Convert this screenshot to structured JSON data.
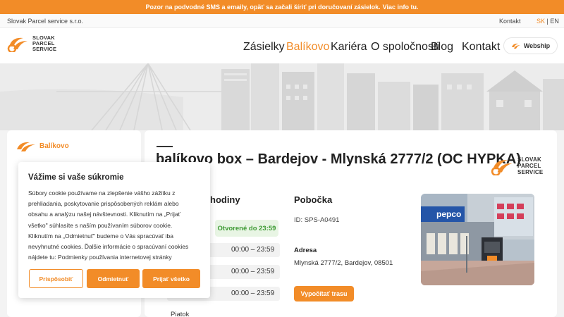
{
  "alert": {
    "text": "Pozor na podvodné SMS a emaily, opäť sa začali šíriť pri doručovaní zásielok.",
    "link": "Viac info tu."
  },
  "topbar": {
    "company": "Slovak Parcel service s.r.o.",
    "contact": "Kontakt",
    "lang_sk": "SK",
    "lang_sep": " | ",
    "lang_en": "EN"
  },
  "logo": {
    "line1": "SLOVAK",
    "line2": "PARCEL",
    "line3": "SERVICE"
  },
  "nav": {
    "items": [
      "Zásielky",
      "Balíkovo",
      "Kariéra",
      "O spoločnosti",
      "Blog",
      "Kontakt"
    ],
    "active_index": 1
  },
  "webship": {
    "label": "Webship"
  },
  "sidebar": {
    "title": "Balíkovo"
  },
  "main": {
    "title": "balíkovo box – Bardejov - Mlynská 2777/2 (OC HYPKA)",
    "hours_heading": "hodiny",
    "open_status": "Otvorené do 23:59",
    "hours": [
      {
        "day": "",
        "time": "00:00 – 23:59"
      },
      {
        "day": "",
        "time": "00:00 – 23:59"
      },
      {
        "day": "",
        "time": "00:00 – 23:59"
      },
      {
        "day": "Piatok",
        "time": ""
      }
    ],
    "branch_heading": "Pobočka",
    "branch_id": "ID: SPS-A0491",
    "address_label": "Adresa",
    "address_value": "Mlynská 2777/2, Bardejov, 08501",
    "route_button": "Vypočítať trasu",
    "photo_sign": "pepco"
  },
  "cookie": {
    "title": "Vážime si vaše súkromie",
    "lines": [
      "Súbory cookie používame na zlepšenie vášho zážitku z",
      "prehliadania, poskytovanie prispôsobených reklám alebo",
      "obsahu a analýzu našej návštevnosti. Kliknutím na „Prijať",
      "všetko\" súhlasíte s naším používaním súborov cookie.",
      "Kliknutím na „Odmietnuť\" budeme o Vás spracúvať iba",
      "nevyhnutné cookies. Ďalšie informácie o spracúvaní cookies",
      "nájdete tu: Podmienky používania internetovej stránky"
    ],
    "customize": "Prispôsobiť",
    "reject": "Odmietnuť",
    "accept_all": "Prijať všetko"
  },
  "colors": {
    "brand_orange": "#f28c28",
    "open_green": "#3d9a33"
  }
}
